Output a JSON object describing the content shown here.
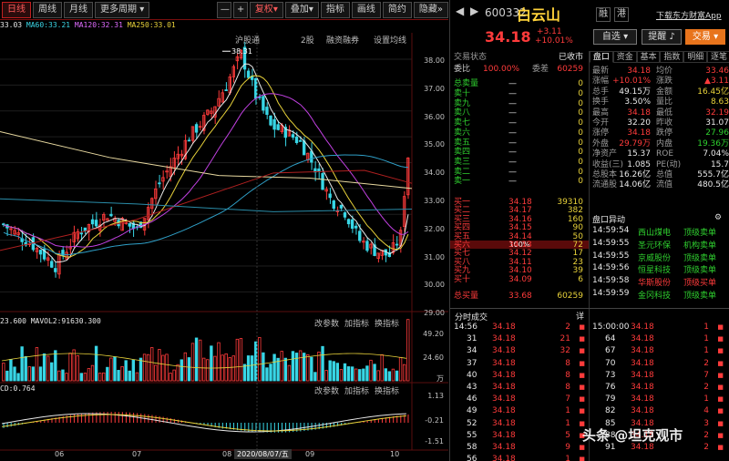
{
  "toolbar": {
    "tabs": [
      "日线",
      "周线",
      "月线",
      "更多周期"
    ],
    "right_tabs": [
      "复权",
      "叠加",
      "指标",
      "画线",
      "简约",
      "隐藏"
    ],
    "active_tab": "日线",
    "minus": "—",
    "plus": "+"
  },
  "ma_line": {
    "ma1": "33.03",
    "ma60": "MA60:33.21",
    "ma120": "MA120:32.31",
    "ma250": "MA250:33.01"
  },
  "indicator_links": [
    "沪股通",
    "2股",
    "融资融券",
    "设置均线"
  ],
  "peak_label": "38.31",
  "price_axis": [
    "38.00",
    "37.00",
    "36.00",
    "35.00",
    "34.00",
    "33.00",
    "32.00",
    "31.00",
    "30.00",
    "29.00"
  ],
  "volume": {
    "head": "23.600  MAVOL2:91630.300",
    "scale": [
      "49.20",
      "24.60",
      "万"
    ],
    "controls": [
      "改参数",
      "加指标",
      "换指标"
    ]
  },
  "macd": {
    "head": "CD:0.764",
    "scale": [
      "1.13",
      "-0.21",
      "-1.51"
    ],
    "controls": [
      "改参数",
      "加指标",
      "换指标"
    ]
  },
  "dates": [
    "06",
    "07",
    "08",
    "2020/08/07/五",
    "09",
    "10"
  ],
  "stock": {
    "code": "600332",
    "name": "白云山",
    "price": "34.18",
    "change": "+3.11",
    "pct": "+10.01%",
    "flags": [
      "融",
      "港"
    ],
    "download": "下载东方财富App"
  },
  "buttons": {
    "auto": "自选",
    "alert": "提醒",
    "trade": "交易"
  },
  "orderbook": {
    "state_label": "交易状态",
    "state": "已收市",
    "ratio_label": "委比",
    "ratio": "100.00%",
    "diff_label": "委差",
    "diff": "60259",
    "sell_total_label": "总卖量",
    "sell_total": "—",
    "sell_total_v": "0",
    "sells": [
      [
        "卖十",
        "—",
        "0"
      ],
      [
        "卖九",
        "—",
        "0"
      ],
      [
        "卖八",
        "—",
        "0"
      ],
      [
        "卖七",
        "—",
        "0"
      ],
      [
        "卖六",
        "—",
        "0"
      ],
      [
        "卖五",
        "—",
        "0"
      ],
      [
        "卖四",
        "—",
        "0"
      ],
      [
        "卖三",
        "—",
        "0"
      ],
      [
        "卖二",
        "—",
        "0"
      ],
      [
        "卖一",
        "—",
        "0"
      ]
    ],
    "mid": "100%",
    "buys": [
      [
        "买一",
        "34.18",
        "39310"
      ],
      [
        "买二",
        "34.17",
        "382"
      ],
      [
        "买三",
        "34.16",
        "160"
      ],
      [
        "买四",
        "34.15",
        "90"
      ],
      [
        "买五",
        "34.14",
        "50"
      ],
      [
        "买六",
        "34.13",
        "72"
      ],
      [
        "买七",
        "34.12",
        "17"
      ],
      [
        "买八",
        "34.11",
        "23"
      ],
      [
        "买九",
        "34.10",
        "39"
      ],
      [
        "买十",
        "34.09",
        "6"
      ]
    ],
    "buy_total_label": "总买量",
    "buy_total": "33.68",
    "buy_total_v": "60259"
  },
  "stats": {
    "tabs": [
      "盘口",
      "资金",
      "基本",
      "指数",
      "明细",
      "逐笔"
    ],
    "rows": [
      [
        "最新",
        "34.18",
        "均价",
        "33.46"
      ],
      [
        "涨幅",
        "+10.01%",
        "涨跌",
        "▲3.11"
      ],
      [
        "总手",
        "49.15万",
        "金额",
        "16.45亿"
      ],
      [
        "换手",
        "3.50%",
        "量比",
        "8.63"
      ],
      [
        "最高",
        "34.18",
        "最低",
        "32.19"
      ],
      [
        "今开",
        "32.20",
        "昨收",
        "31.07"
      ],
      [
        "涨停",
        "34.18",
        "跌停",
        "27.96"
      ],
      [
        "外盘",
        "29.79万",
        "内盘",
        "19.36万"
      ],
      [
        "净资产",
        "15.37",
        "ROE",
        "7.04%"
      ],
      [
        "收益(三)",
        "1.085",
        "PE(动)",
        "15.7"
      ],
      [
        "总股本",
        "16.26亿",
        "总值",
        "555.7亿"
      ],
      [
        "流通股",
        "14.06亿",
        "流值",
        "480.5亿"
      ]
    ]
  },
  "movers": {
    "title": "盘口异动",
    "rows": [
      [
        "14:59:54",
        "西山煤电",
        "顶级卖单"
      ],
      [
        "14:59:55",
        "圣元环保",
        "机构卖单"
      ],
      [
        "14:59:55",
        "京威股份",
        "顶级卖单"
      ],
      [
        "14:59:56",
        "恒星科技",
        "顶级卖单"
      ],
      [
        "14:59:58",
        "华斯股份",
        "顶级买单"
      ],
      [
        "14:59:59",
        "金冈科技",
        "顶级卖单"
      ]
    ]
  },
  "trades": {
    "title": "分时成交",
    "left": [
      [
        "14:56",
        "34.18",
        "2"
      ],
      [
        "31",
        "34.18",
        "21"
      ],
      [
        "34",
        "34.18",
        "32"
      ],
      [
        "37",
        "34.18",
        "8"
      ],
      [
        "40",
        "34.18",
        "8"
      ],
      [
        "43",
        "34.18",
        "8"
      ],
      [
        "46",
        "34.18",
        "7"
      ],
      [
        "49",
        "34.18",
        "1"
      ],
      [
        "52",
        "34.18",
        "1"
      ],
      [
        "55",
        "34.18",
        "5"
      ],
      [
        "58",
        "34.18",
        "9"
      ],
      [
        "56",
        "34.18",
        "1"
      ]
    ],
    "right": [
      [
        "15:00:00",
        "34.18",
        "1"
      ],
      [
        "64",
        "34.18",
        "1"
      ],
      [
        "67",
        "34.18",
        "1"
      ],
      [
        "70",
        "34.18",
        "2"
      ],
      [
        "73",
        "34.18",
        "7"
      ],
      [
        "76",
        "34.18",
        "2"
      ],
      [
        "79",
        "34.18",
        "1"
      ],
      [
        "82",
        "34.18",
        "4"
      ],
      [
        "85",
        "34.18",
        "3"
      ],
      [
        "88",
        "34.18",
        "2"
      ],
      [
        "91",
        "34.18",
        "2"
      ]
    ]
  },
  "watermark": "头条 @坦克观市"
}
